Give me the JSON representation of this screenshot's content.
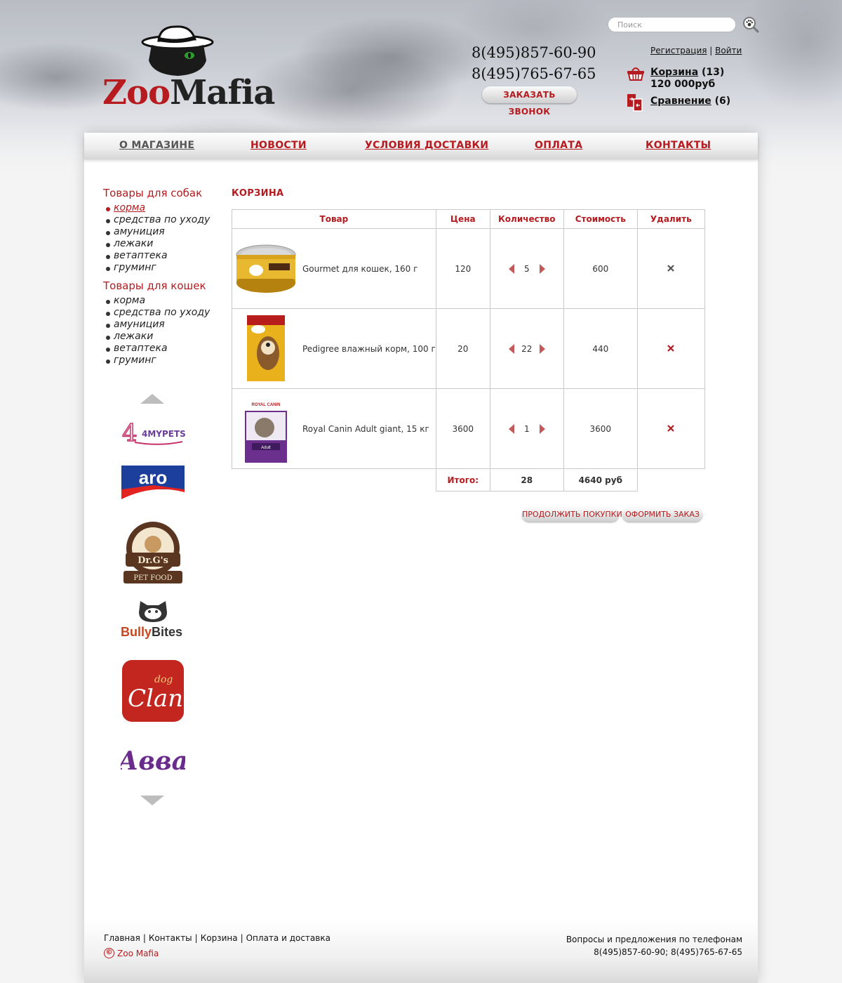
{
  "brand": {
    "logo_part1": "Zoo",
    "logo_part2": "Mafia"
  },
  "header": {
    "phones": [
      "8(495)857-60-90",
      "8(495)765-67-65"
    ],
    "callback_label": "ЗАКАЗАТЬ ЗВОНОК",
    "search_placeholder": "Поиск",
    "register_label": "Регистрация",
    "auth_separator": "|",
    "login_label": "Войти",
    "cart_label": "Корзина",
    "cart_count": "(13)",
    "cart_sum": "120 000руб",
    "compare_label": "Сравнение",
    "compare_count": "(6)"
  },
  "nav": {
    "items": [
      {
        "label": "О МАГАЗИНЕ",
        "active": true
      },
      {
        "label": "НОВОСТИ",
        "active": false
      },
      {
        "label": "УСЛОВИЯ ДОСТАВКИ",
        "active": false
      },
      {
        "label": "ОПЛАТА",
        "active": false
      },
      {
        "label": "КОНТАКТЫ",
        "active": false
      }
    ]
  },
  "sidebar": {
    "dogs_title": "Товары для собак",
    "dogs_items": [
      "корма",
      "средства по уходу",
      "амуниция",
      "лежаки",
      "ветаптека",
      "груминг"
    ],
    "cats_title": "Товары для кошек",
    "cats_items": [
      "корма",
      "средства по уходу",
      "амуниция",
      "лежаки",
      "ветаптека",
      "груминг"
    ],
    "brands": [
      "4MYPETS",
      "aro",
      "Dr.G's Fresh Pet Food",
      "Bully Bites",
      "dog Clan",
      "Авва"
    ]
  },
  "cart": {
    "title": "КОРЗИНА",
    "headers": [
      "Товар",
      "Цена",
      "Количество",
      "Стоимость",
      "Удалить"
    ],
    "rows": [
      {
        "name": "Gourmet для кошек, 160 г",
        "price": "120",
        "qty": "5",
        "cost": "600"
      },
      {
        "name": "Pedigree влажный корм, 100 г",
        "price": "20",
        "qty": "22",
        "cost": "440"
      },
      {
        "name": "Royal Canin Adult giant, 15 кг",
        "price": "3600",
        "qty": "1",
        "cost": "3600"
      }
    ],
    "total_label": "Итого:",
    "total_qty": "28",
    "total_sum": "4640 руб",
    "continue_label": "ПРОДОЛЖИТЬ ПОКУПКИ",
    "checkout_label": "ОФОРМИТЬ ЗАКАЗ"
  },
  "footer": {
    "links": [
      "Главная",
      "Контакты",
      "Корзина",
      "Оплата и доставка"
    ],
    "separator": "|",
    "copyright": "Zoo Mafia",
    "contact_line1": "Вопросы и предложения по телефонам",
    "contact_line2": "8(495)857-60-90; 8(495)765-67-65"
  },
  "colors": {
    "accent": "#b51b1f",
    "text": "#333333",
    "border": "#c9c9c9"
  }
}
